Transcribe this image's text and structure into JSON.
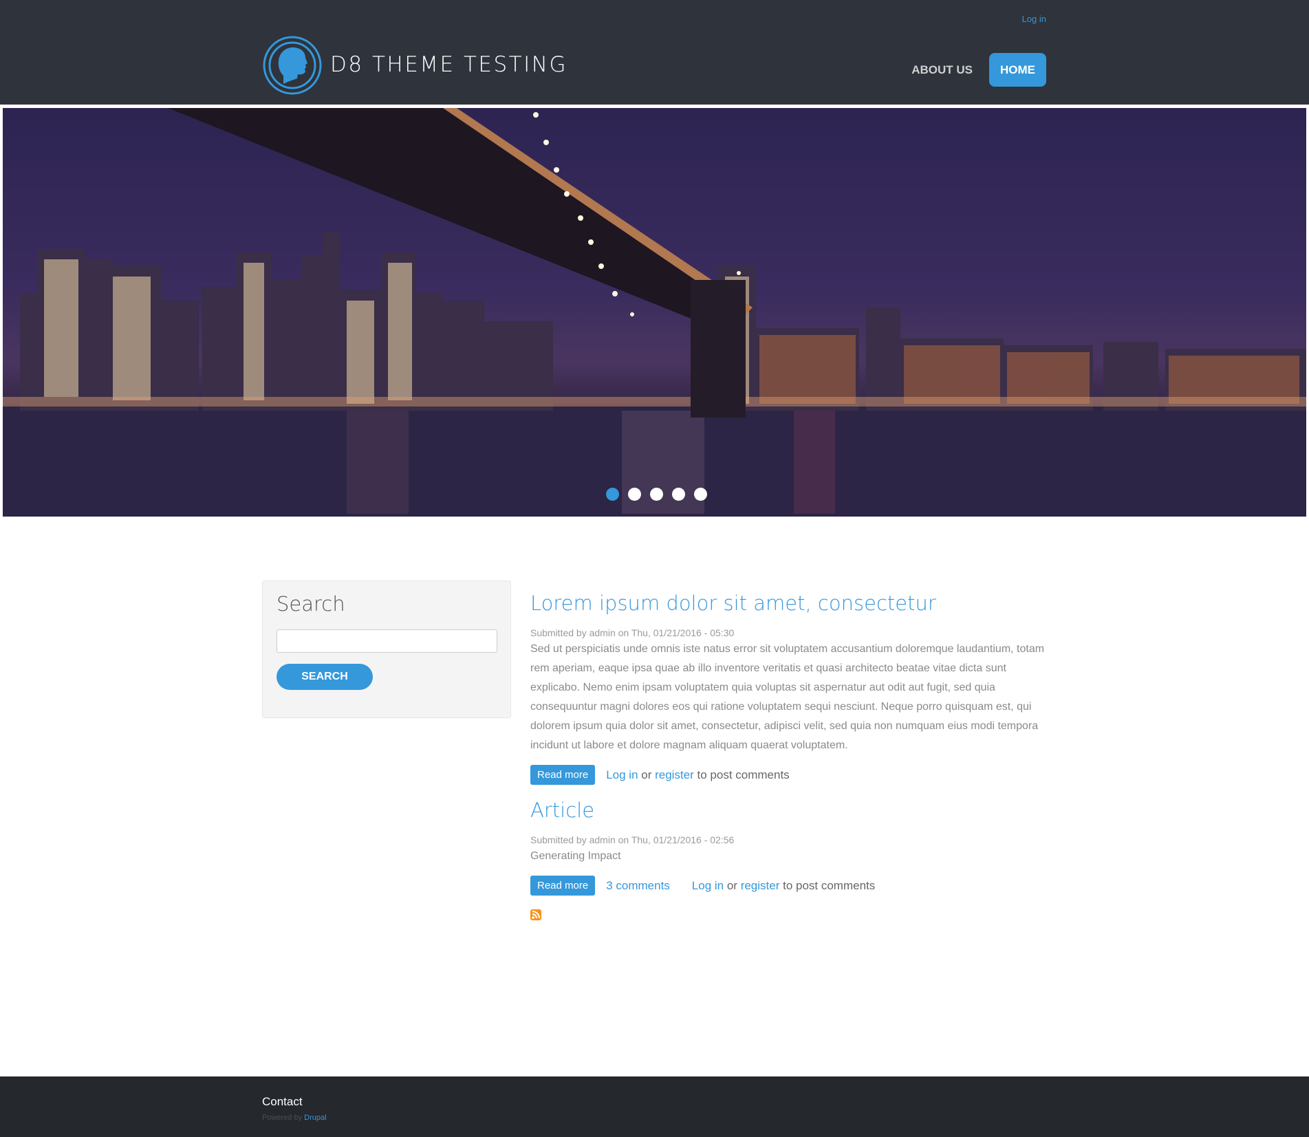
{
  "header": {
    "site_name": "D8 THEME TESTING",
    "logo_icon": "head-profile-logo-icon",
    "login_label": "Log in",
    "nav": [
      {
        "label": "ABOUT US",
        "active": false
      },
      {
        "label": "HOME",
        "active": true
      }
    ]
  },
  "slider": {
    "slide_count": 5,
    "active_index": 0,
    "image_description": "Brooklyn Bridge and city skyline at night over the river"
  },
  "sidebar": {
    "search_title": "Search",
    "search_input_value": "",
    "search_button_label": "SEARCH"
  },
  "articles": [
    {
      "title": "Lorem ipsum dolor sit amet, consectetur",
      "meta": "Submitted by admin on Thu, 01/21/2016 - 05:30",
      "body": "Sed ut perspiciatis unde omnis iste natus error sit voluptatem accusantium doloremque laudantium, totam rem aperiam, eaque ipsa quae ab illo inventore veritatis et quasi architecto beatae vitae dicta sunt explicabo. Nemo enim ipsam voluptatem quia voluptas sit aspernatur aut odit aut fugit, sed quia consequuntur magni dolores eos qui ratione voluptatem sequi nesciunt. Neque porro quisquam est, qui dolorem ipsum quia dolor sit amet, consectetur, adipisci velit, sed quia non numquam eius modi tempora incidunt ut labore et dolore magnam aliquam quaerat voluptatem.",
      "read_more": "Read more",
      "login_label": "Log in",
      "or_text": " or ",
      "register_label": "register",
      "post_text": " to post comments"
    },
    {
      "title": "Article",
      "meta": "Submitted by admin on Thu, 01/21/2016 - 02:56",
      "body": "Generating Impact",
      "read_more": "Read more",
      "comments_label": "3 comments",
      "login_label": "Log in",
      "or_text": " or ",
      "register_label": "register",
      "post_text": " to post comments"
    }
  ],
  "feed_icon": "rss-feed-icon",
  "footer": {
    "contact_label": "Contact",
    "powered_text": "Powered by ",
    "drupal_label": "Drupal"
  },
  "colors": {
    "accent": "#3498db",
    "header_bg": "#2f333b",
    "footer_bg": "#25282d",
    "sidebar_bg": "#f4f4f4",
    "rss": "#f7941d"
  }
}
